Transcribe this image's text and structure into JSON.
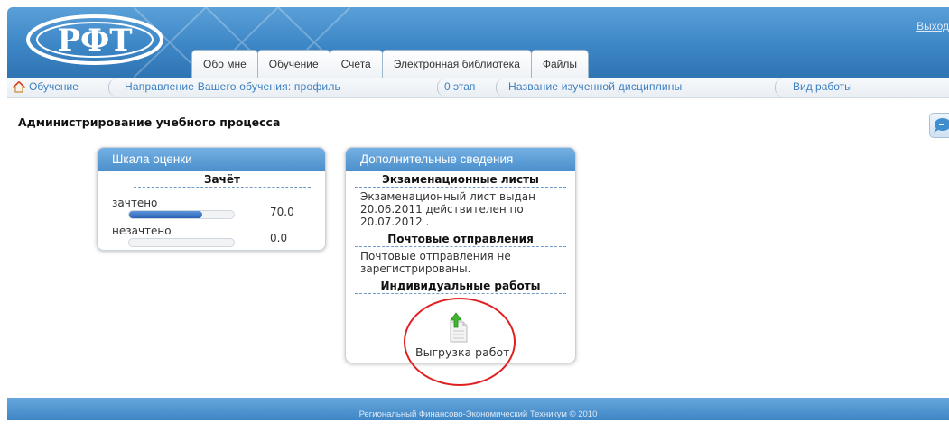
{
  "header": {
    "logout": "Выход",
    "tabs": [
      "Обо мне",
      "Обучение",
      "Счета",
      "Электронная библиотека",
      "Файлы"
    ]
  },
  "breadcrumb": {
    "home": "Обучение",
    "direction": "Направление Вашего обучения: профиль",
    "stage": "0 этап",
    "discipline": "Название изученной дисциплины",
    "work_type": "Вид работы"
  },
  "page": {
    "title": "Администрирование учебного процесса"
  },
  "grade_panel": {
    "title": "Шкала оценки",
    "subtitle": "Зачёт",
    "rows": [
      {
        "label": "зачтено",
        "value": "70.0",
        "progress": 0.7
      },
      {
        "label": "незачтено",
        "value": "0.0",
        "progress": 0.0
      }
    ]
  },
  "info_panel": {
    "title": "Дополнительные сведения",
    "exam_heading": "Экзаменационные листы",
    "exam_text": "Экзаменационный лист выдан 20.06.2011 действителен по 20.07.2012 .",
    "mail_heading": "Почтовые отправления",
    "mail_text": "Почтовые отправления не зарегистрированы.",
    "works_heading": "Индивидуальные работы",
    "upload_label": "Выгрузка работ"
  },
  "footer": {
    "text": "Региональный Финансово-Экономический Техникум © 2010"
  },
  "colors": {
    "header": "#3d86c6",
    "link": "#3b7fbf",
    "highlight": "#e02020"
  }
}
